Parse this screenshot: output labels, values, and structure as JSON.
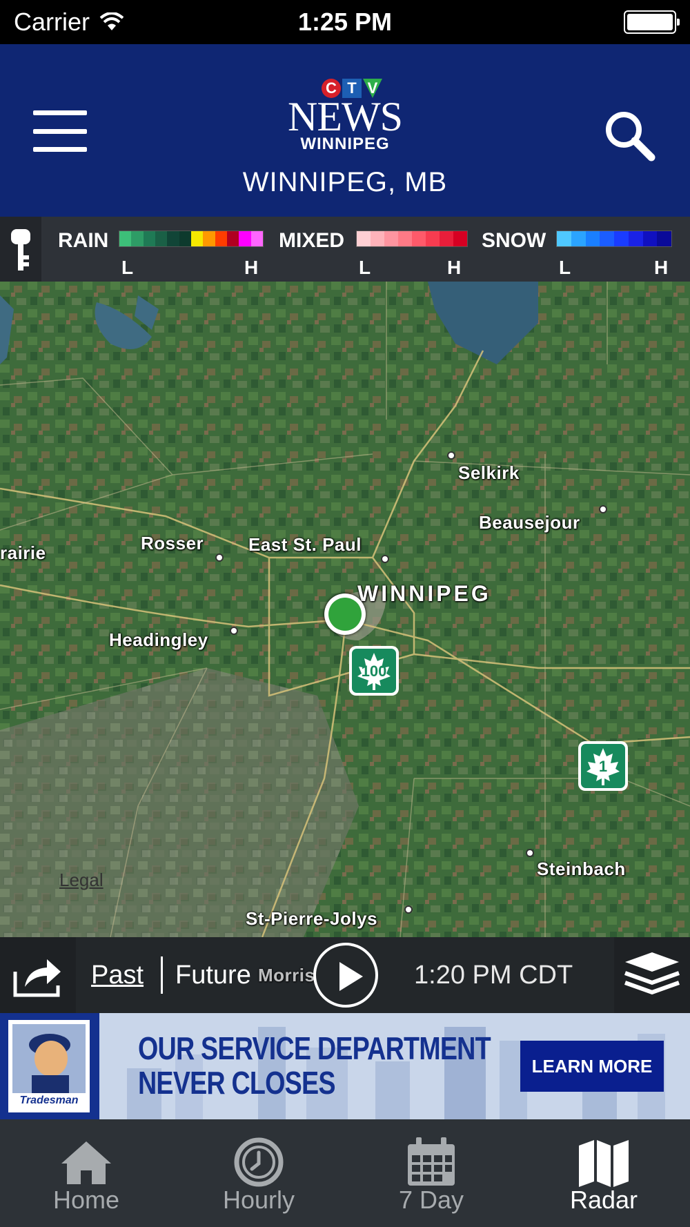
{
  "status_bar": {
    "carrier": "Carrier",
    "time": "1:25 PM"
  },
  "header": {
    "logo_ctv": [
      "C",
      "T",
      "V"
    ],
    "logo_news": "NEWS",
    "logo_city": "WINNIPEG",
    "location": "WINNIPEG, MB"
  },
  "legend": {
    "rain": {
      "label": "RAIN",
      "low": "L",
      "high": "H",
      "colors": [
        "#3dbf79",
        "#2e9c66",
        "#1f7a55",
        "#1a6046",
        "#114537",
        "#0d3a2d",
        "#f5e900",
        "#ff9900",
        "#ff3d00",
        "#b00020",
        "#ff00ff",
        "#ff66ff"
      ]
    },
    "mixed": {
      "label": "MIXED",
      "low": "L",
      "high": "H",
      "colors": [
        "#ffd0d4",
        "#ffb3ba",
        "#ff95a0",
        "#ff7a86",
        "#ff5a6a",
        "#f73c50",
        "#e81e3a",
        "#d60022"
      ]
    },
    "snow": {
      "label": "SNOW",
      "low": "L",
      "high": "H",
      "colors": [
        "#4fc8ff",
        "#2ba4ff",
        "#1a7fff",
        "#1b5dff",
        "#1a3cff",
        "#1a22e6",
        "#1010c0",
        "#0a0a99"
      ]
    }
  },
  "map": {
    "places": {
      "selkirk": "Selkirk",
      "beausejour": "Beausejour",
      "rosser": "Rosser",
      "east_st_paul": "East St. Paul",
      "prairie": "rairie",
      "winnipeg": "WINNIPEG",
      "headingley": "Headingley",
      "steinbach": "Steinbach",
      "st_pierre_jolys": "St-Pierre-Jolys",
      "morris": "Morris"
    },
    "highways": {
      "hwy100": "100",
      "hwy1": "1"
    },
    "legal": "Legal"
  },
  "playback": {
    "past": "Past",
    "future": "Future",
    "timestamp": "1:20 PM CDT"
  },
  "ad": {
    "brand": "Tradesman",
    "headline_1": "OUR SERVICE DEPARTMENT",
    "headline_2": "NEVER CLOSES",
    "cta": "LEARN MORE"
  },
  "tabs": [
    {
      "label": "Home",
      "icon": "home-icon",
      "active": false
    },
    {
      "label": "Hourly",
      "icon": "clock-icon",
      "active": false
    },
    {
      "label": "7 Day",
      "icon": "calendar-icon",
      "active": false
    },
    {
      "label": "Radar",
      "icon": "map-icon",
      "active": true
    }
  ]
}
